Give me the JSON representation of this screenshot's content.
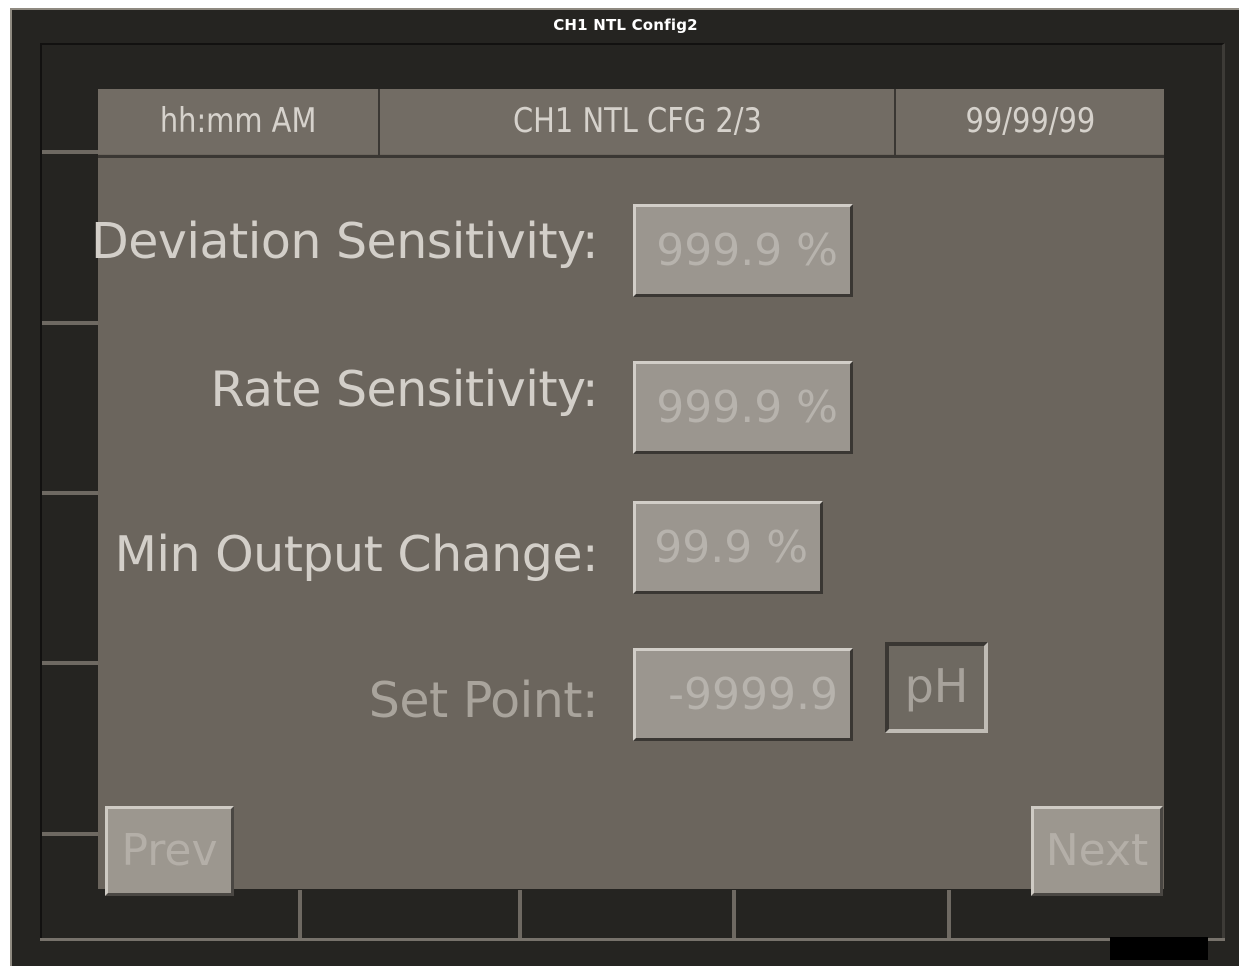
{
  "window": {
    "title": "CH1 NTL Config2"
  },
  "header": {
    "time": "hh:mm AM",
    "screen_title": "CH1 NTL CFG 2/3",
    "date": "99/99/99"
  },
  "fields": {
    "deviation_sensitivity": {
      "label": "Deviation Sensitivity:",
      "value": "999.9 %"
    },
    "rate_sensitivity": {
      "label": "Rate Sensitivity:",
      "value": "999.9 %"
    },
    "min_output_change": {
      "label": "Min Output Change:",
      "value": "99.9 %"
    },
    "set_point": {
      "label": "Set Point:",
      "value": "-9999.9",
      "unit": "pH"
    }
  },
  "nav": {
    "prev_label": "Prev",
    "next_label": "Next"
  },
  "colors": {
    "frame": "#252421",
    "screen": "#6b655d",
    "header_cell": "#726c64",
    "field": "#9b968f",
    "label_text": "#d3cfc9"
  }
}
